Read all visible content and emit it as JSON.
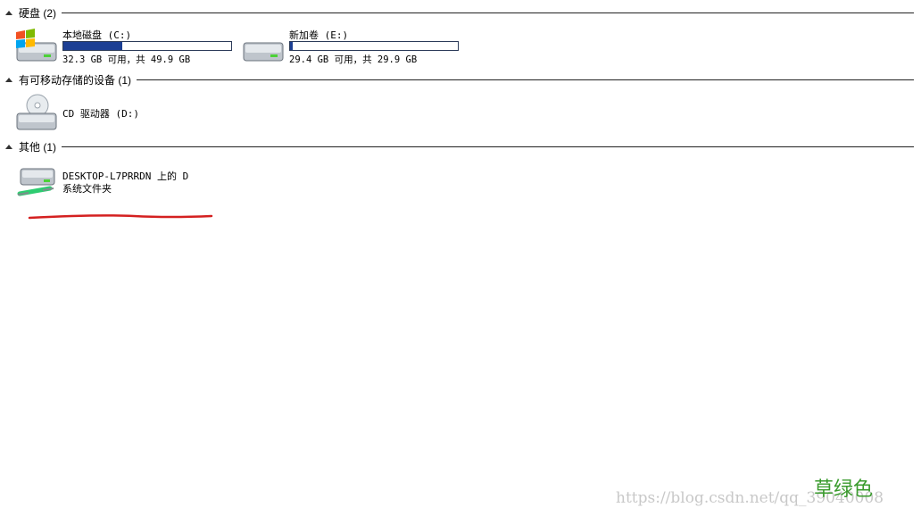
{
  "groups": {
    "hard_disks": {
      "title": "硬盘 (2)",
      "items": [
        {
          "name": "本地磁盘 (C:)",
          "stat": "32.3 GB 可用，共 49.9 GB",
          "used_fraction": 0.353
        },
        {
          "name": "新加卷 (E:)",
          "stat": "29.4 GB 可用，共 29.9 GB",
          "used_fraction": 0.017
        }
      ]
    },
    "removable": {
      "title": "有可移动存储的设备 (1)",
      "items": [
        {
          "name": "CD 驱动器 (D:)"
        }
      ]
    },
    "other": {
      "title": "其他 (1)",
      "items": [
        {
          "name": "DESKTOP-L7PRRDN 上的 D",
          "sub": "系统文件夹"
        }
      ]
    }
  },
  "watermark": {
    "text": "草绿色",
    "url": "https://blog.csdn.net/qq_39040008"
  },
  "colors": {
    "bar_fill": "#1c3f94",
    "annotation_red": "#d42020",
    "watermark_green": "#3a9b2d"
  }
}
